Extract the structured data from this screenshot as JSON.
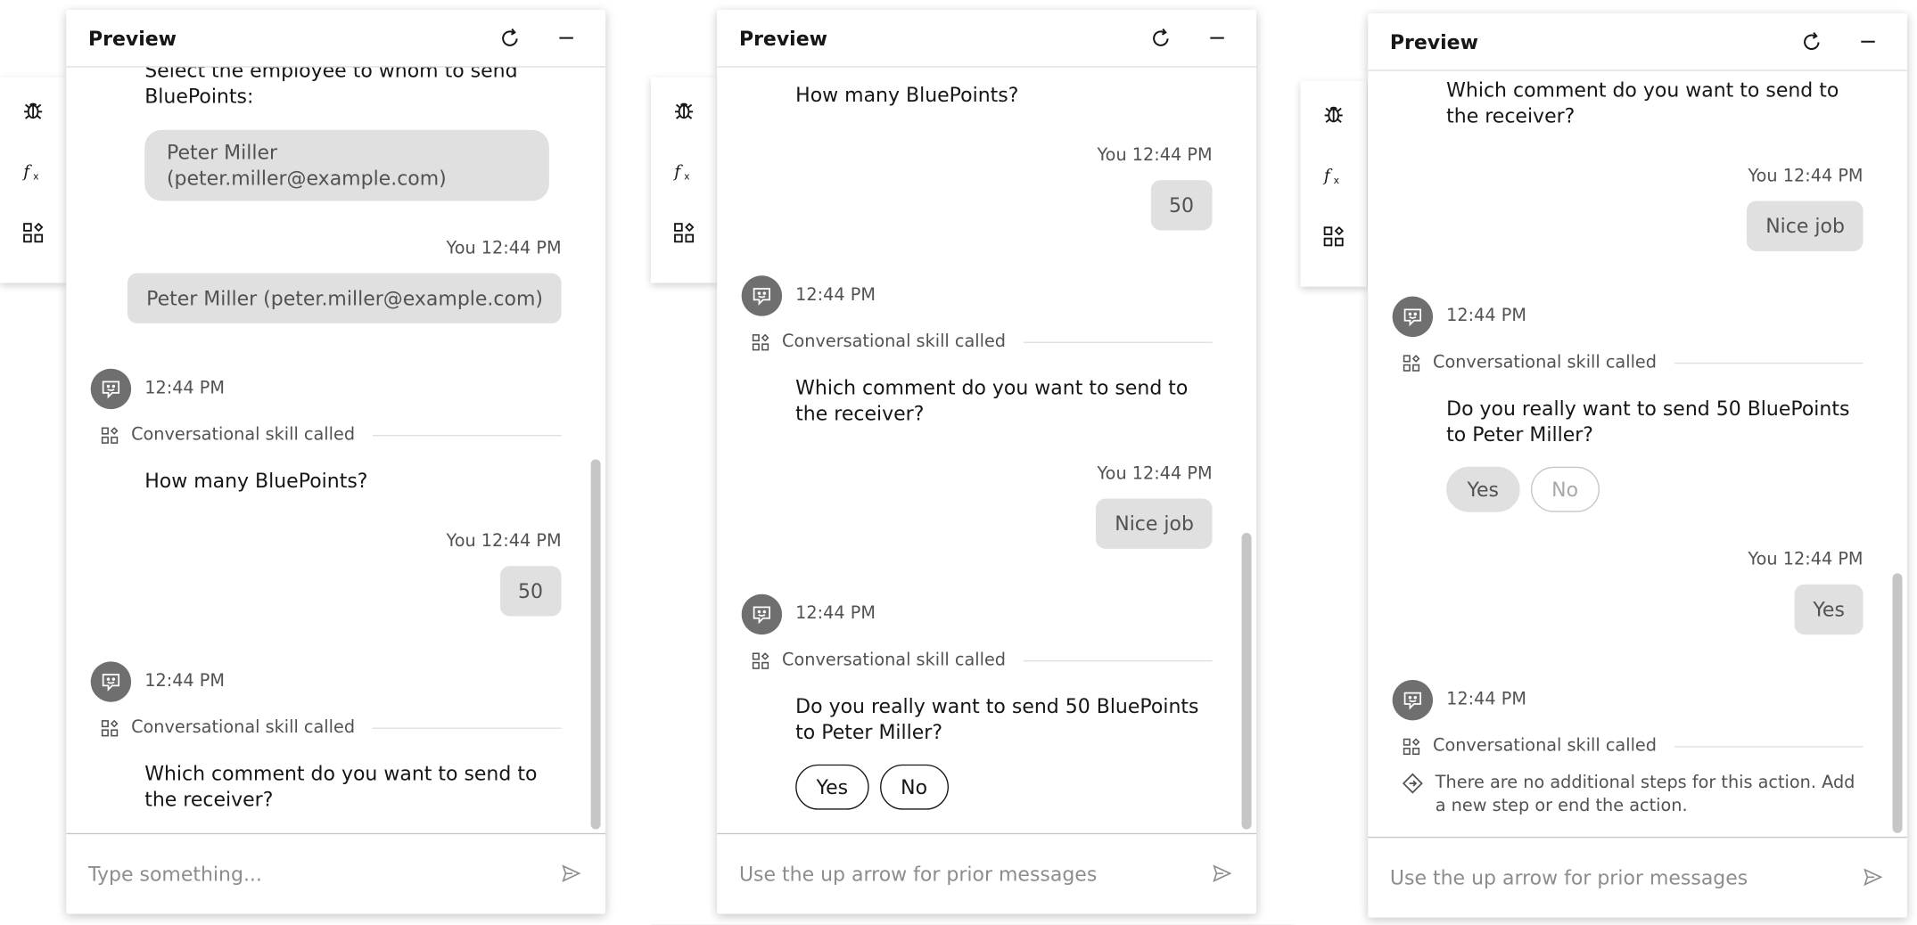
{
  "panels": [
    {
      "title": "Preview",
      "input_placeholder": "Type something...",
      "select_prompt": "Select the employee to whom to send BluePoints:",
      "choice_option": "Peter Miller (peter.miller@example.com)",
      "you_label_1": "You 12:44 PM",
      "you_reply_1": "Peter Miller (peter.miller@example.com)",
      "bot_time_1": "12:44 PM",
      "skill_1": "Conversational skill called",
      "bot_msg_1": "How many BluePoints?",
      "you_label_2": "You 12:44 PM",
      "you_reply_2": "50",
      "bot_time_2": "12:44 PM",
      "skill_2": "Conversational skill called",
      "bot_msg_2": "Which comment do you want to send to the receiver?"
    },
    {
      "title": "Preview",
      "input_placeholder": "Use the up arrow for prior messages",
      "bot_msg_0": "How many BluePoints?",
      "you_label_1": "You 12:44 PM",
      "you_reply_1": "50",
      "bot_time_1": "12:44 PM",
      "skill_1": "Conversational skill called",
      "bot_msg_1": "Which comment do you want to send to the receiver?",
      "you_label_2": "You 12:44 PM",
      "you_reply_2": "Nice job",
      "bot_time_2": "12:44 PM",
      "skill_2": "Conversational skill called",
      "bot_msg_2": "Do you really want to send 50 BluePoints to Peter Miller?",
      "yes_label": "Yes",
      "no_label": "No"
    },
    {
      "title": "Preview",
      "input_placeholder": "Use the up arrow for prior messages",
      "bot_msg_0": "Which comment do you want to send to the receiver?",
      "you_label_1": "You 12:44 PM",
      "you_reply_1": "Nice job",
      "bot_time_1": "12:44 PM",
      "skill_1": "Conversational skill called",
      "bot_msg_1": "Do you really want to send 50 BluePoints to Peter Miller?",
      "yes_label": "Yes",
      "no_label": "No",
      "you_label_2": "You 12:44 PM",
      "you_reply_2": "Yes",
      "bot_time_2": "12:44 PM",
      "skill_2": "Conversational skill called",
      "note": "There are no additional steps for this action. Add a new step or end the action."
    }
  ],
  "icons": {
    "toolbar": [
      "debug-icon",
      "function-icon",
      "skill-icon"
    ],
    "header": [
      "refresh-icon",
      "minimize-icon"
    ],
    "send": "send-icon",
    "avatar": "bot-chat-icon",
    "skill": "skill-icon",
    "note": "diamond-step-icon"
  },
  "colors": {
    "avatar": "#6f6f6f",
    "bubble": "#e0e0e0",
    "text": "#161616",
    "muted": "#525252",
    "placeholder": "#8d8d8d"
  }
}
